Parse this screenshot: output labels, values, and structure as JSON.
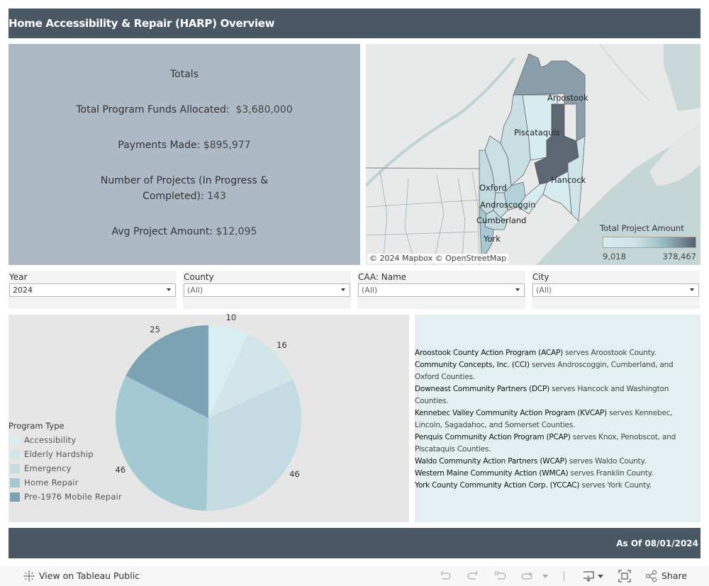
{
  "header": {
    "title": "Home Accessibility & Repair (HARP) Overview"
  },
  "totals": {
    "heading": "Totals",
    "funds_label": "Total Program Funds Allocated:",
    "funds_value": "$3,680,000",
    "payments_label": "Payments Made:",
    "payments_value": "$895,977",
    "projects_label_1": "Number of Projects (In Progress &",
    "projects_label_2": "Completed):",
    "projects_value": "143",
    "avg_label": "Avg Project Amount:",
    "avg_value": "$12,095"
  },
  "map": {
    "county_labels": [
      "Aroostook",
      "Piscataquis",
      "Hancock",
      "Oxford",
      "Androscoggin",
      "Cumberland",
      "York"
    ],
    "attribution": "© 2024 Mapbox  © OpenStreetMap",
    "legend": {
      "title": "Total Project Amount",
      "min": "9,018",
      "max": "378,467",
      "min_color": "#d7ecef",
      "max_color": "#565f6b"
    }
  },
  "filters": [
    {
      "label": "Year",
      "value": "2024"
    },
    {
      "label": "County",
      "value": "(All)"
    },
    {
      "label": "CAA: Name",
      "value": "(All)"
    },
    {
      "label": "City",
      "value": "(All)"
    }
  ],
  "chart_data": {
    "type": "pie",
    "title": "",
    "legend_title": "Program Type",
    "legend_position": "left",
    "categories": [
      "Accessibility",
      "Elderly Hardship",
      "Emergency",
      "Home Repair",
      "Pre-1976 Mobile Repair"
    ],
    "values": [
      10,
      16,
      46,
      46,
      25
    ],
    "colors": [
      "#d8eff2",
      "#d2e6ea",
      "#c4dce1",
      "#a5c9d2",
      "#7ba3b3"
    ]
  },
  "caa": {
    "entries": [
      {
        "org": "Aroostook County Action Program (ACAP)",
        "text": " serves Aroostook County."
      },
      {
        "org": "Community Concepts, Inc. (CCI)",
        "text": " serves Androscoggin, Cumberland, and Oxford Counties."
      },
      {
        "org": "Downeast Community Partners (DCP)",
        "text": " serves Hancock and Washington Counties."
      },
      {
        "org": "Kennebec Valley Community Action Program (KVCAP)",
        "text": " serves Kennebec, Lincoln, Sagadahoc, and Somerset Counties."
      },
      {
        "org": "Penquis Community Action Program (PCAP)",
        "text": " serves Knox, Penobscot, and Piscataquis  Counties."
      },
      {
        "org": "Waldo Community Action Partners (WCAP)",
        "text": " serves Waldo County."
      },
      {
        "org": "Western Maine Community Action (WMCA)",
        "text": " serves Franklin County."
      },
      {
        "org": "York County Community Action Corp. (YCCAC)",
        "text": " serves York County."
      }
    ]
  },
  "footer": {
    "as_of": "As Of 08/01/2024"
  },
  "toolbar": {
    "view_on_public": "View on Tableau Public",
    "share": "Share"
  }
}
